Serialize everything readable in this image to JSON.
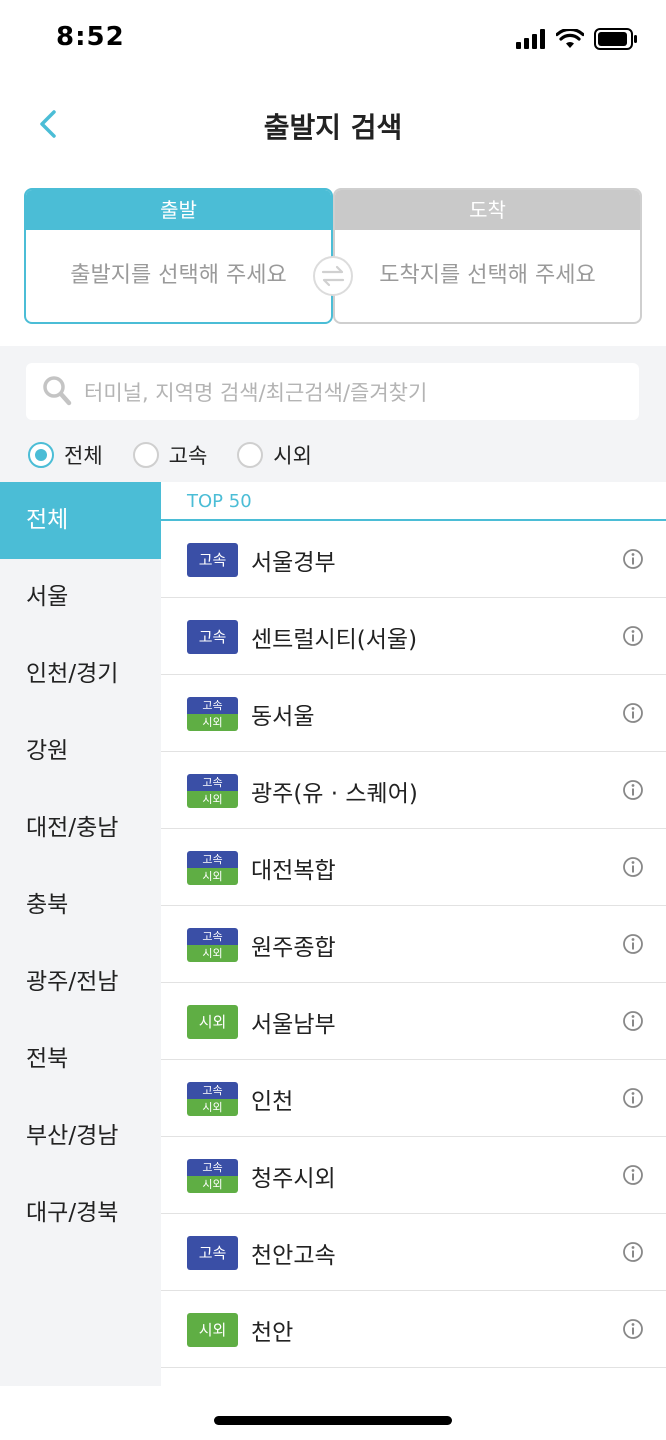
{
  "status": {
    "time": "8:52"
  },
  "nav": {
    "title": "출발지 검색"
  },
  "route": {
    "depart_label": "출발",
    "depart_placeholder": "출발지를 선택해 주세요",
    "arrive_label": "도착",
    "arrive_placeholder": "도착지를 선택해 주세요"
  },
  "search": {
    "placeholder": "터미널, 지역명 검색/최근검색/즐겨찾기"
  },
  "filters": [
    {
      "label": "전체",
      "selected": true
    },
    {
      "label": "고속",
      "selected": false
    },
    {
      "label": "시외",
      "selected": false
    }
  ],
  "sidebar": {
    "items": [
      {
        "label": "전체",
        "active": true
      },
      {
        "label": "서울"
      },
      {
        "label": "인천/경기"
      },
      {
        "label": "강원"
      },
      {
        "label": "대전/충남"
      },
      {
        "label": "충북"
      },
      {
        "label": "광주/전남"
      },
      {
        "label": "전북"
      },
      {
        "label": "부산/경남"
      },
      {
        "label": "대구/경북"
      }
    ]
  },
  "list": {
    "header": "TOP 50",
    "badge_labels": {
      "express": "고속",
      "intercity": "시외"
    },
    "rows": [
      {
        "name": "서울경부",
        "type": "express"
      },
      {
        "name": "센트럴시티(서울)",
        "type": "express"
      },
      {
        "name": "동서울",
        "type": "both"
      },
      {
        "name": "광주(유 · 스퀘어)",
        "type": "both"
      },
      {
        "name": "대전복합",
        "type": "both"
      },
      {
        "name": "원주종합",
        "type": "both"
      },
      {
        "name": "서울남부",
        "type": "intercity"
      },
      {
        "name": "인천",
        "type": "both"
      },
      {
        "name": "청주시외",
        "type": "both"
      },
      {
        "name": "천안고속",
        "type": "express"
      },
      {
        "name": "천안",
        "type": "intercity"
      }
    ]
  },
  "colors": {
    "accent": "#4bbdd6",
    "express": "#3a4fa6",
    "intercity": "#5fae44"
  }
}
